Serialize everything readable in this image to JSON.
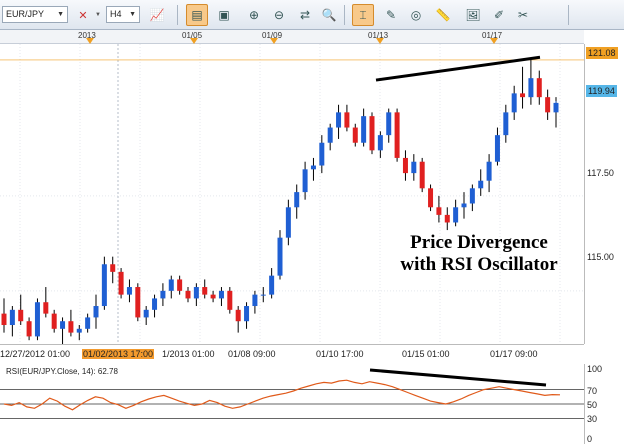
{
  "toolbar": {
    "symbol": "EUR/JPY",
    "timeframe": "H4",
    "buttons": [
      {
        "name": "chart-type-icon",
        "glyph": "📈"
      },
      {
        "name": "bar-chart-icon",
        "glyph": "▤",
        "active": true
      },
      {
        "name": "window-icon",
        "glyph": "▣"
      },
      {
        "name": "zoom-in-icon",
        "glyph": "⊕"
      },
      {
        "name": "zoom-out-icon",
        "glyph": "⊖"
      },
      {
        "name": "scroll-icon",
        "glyph": "⇄"
      },
      {
        "name": "magnifier-icon",
        "glyph": "🔍"
      },
      {
        "name": "cursor-icon",
        "glyph": "⌶",
        "active": true
      },
      {
        "name": "note-icon",
        "glyph": "✎"
      },
      {
        "name": "indicator-icon",
        "glyph": "◎"
      },
      {
        "name": "ruler-icon",
        "glyph": "📏"
      },
      {
        "name": "image-icon",
        "glyph": "🖼"
      },
      {
        "name": "edit-icon",
        "glyph": "✐"
      },
      {
        "name": "settings-icon",
        "glyph": "✂"
      }
    ]
  },
  "timeline": {
    "labels": [
      "2013",
      "01/05",
      "01/09",
      "01/13",
      "01/17"
    ]
  },
  "price_axis": {
    "ticks": [
      "117.50",
      "115.00"
    ],
    "high_badge": "121.08",
    "current_badge": "119.94",
    "high_badge_color": "#f0a023",
    "current_badge_color": "#56b6e8"
  },
  "x_axis": {
    "labels": [
      "12/27/2012 01:00",
      "01/02/2013 17:00",
      "1/2013 01:00",
      "01/08 09:00",
      "01/10 17:00",
      "01/15 01:00",
      "01/17 09:00"
    ],
    "highlight_index": 1
  },
  "rsi": {
    "legend": "RSI(EUR/JPY.Close, 14): 62.78",
    "axis_labels": [
      "100",
      "70",
      "50",
      "30",
      "0"
    ]
  },
  "annotation": {
    "line1": "Price Divergence",
    "line2": "with RSI Oscillator"
  },
  "colors": {
    "bull": "#1f5fd3",
    "bear": "#e02020",
    "rsi_line": "#e05a1a"
  },
  "chart_data": [
    {
      "type": "candlestick",
      "symbol": "EUR/JPY",
      "timeframe": "H4",
      "ylim": [
        113.6,
        121.5
      ],
      "ticks": [
        115.0,
        117.5
      ],
      "candles": [
        [
          114.4,
          114.8,
          113.9,
          114.1
        ],
        [
          114.1,
          114.6,
          113.8,
          114.5
        ],
        [
          114.5,
          114.9,
          114.1,
          114.2
        ],
        [
          114.2,
          114.3,
          113.7,
          113.8
        ],
        [
          113.8,
          114.8,
          113.7,
          114.7
        ],
        [
          114.7,
          115.1,
          114.3,
          114.4
        ],
        [
          114.4,
          114.5,
          113.9,
          114.0
        ],
        [
          114.0,
          114.3,
          113.6,
          114.2
        ],
        [
          114.2,
          114.5,
          113.8,
          113.9
        ],
        [
          113.9,
          114.1,
          113.7,
          114.0
        ],
        [
          114.0,
          114.4,
          113.9,
          114.3
        ],
        [
          114.3,
          114.9,
          114.0,
          114.6
        ],
        [
          114.6,
          115.9,
          114.5,
          115.7
        ],
        [
          115.7,
          115.9,
          115.2,
          115.5
        ],
        [
          115.5,
          115.6,
          114.8,
          114.9
        ],
        [
          114.9,
          115.3,
          114.7,
          115.1
        ],
        [
          115.1,
          115.2,
          114.2,
          114.3
        ],
        [
          114.3,
          114.6,
          114.1,
          114.5
        ],
        [
          114.5,
          114.9,
          114.3,
          114.8
        ],
        [
          114.8,
          115.2,
          114.6,
          115.0
        ],
        [
          115.0,
          115.4,
          114.8,
          115.3
        ],
        [
          115.3,
          115.4,
          114.9,
          115.0
        ],
        [
          115.0,
          115.1,
          114.7,
          114.8
        ],
        [
          114.8,
          115.2,
          114.6,
          115.1
        ],
        [
          115.1,
          115.3,
          114.8,
          114.9
        ],
        [
          114.9,
          115.0,
          114.7,
          114.8
        ],
        [
          114.8,
          115.1,
          114.6,
          115.0
        ],
        [
          115.0,
          115.1,
          114.4,
          114.5
        ],
        [
          114.5,
          114.6,
          113.9,
          114.2
        ],
        [
          114.2,
          114.7,
          114.0,
          114.6
        ],
        [
          114.6,
          115.0,
          114.4,
          114.9
        ],
        [
          114.9,
          115.1,
          114.7,
          114.9
        ],
        [
          114.9,
          115.6,
          114.8,
          115.4
        ],
        [
          115.4,
          116.6,
          115.3,
          116.4
        ],
        [
          116.4,
          117.4,
          116.2,
          117.2
        ],
        [
          117.2,
          117.8,
          116.9,
          117.6
        ],
        [
          117.6,
          118.4,
          117.4,
          118.2
        ],
        [
          118.2,
          118.5,
          117.9,
          118.3
        ],
        [
          118.3,
          119.1,
          118.1,
          118.9
        ],
        [
          118.9,
          119.4,
          118.7,
          119.3
        ],
        [
          119.3,
          119.9,
          119.0,
          119.7
        ],
        [
          119.7,
          119.9,
          119.2,
          119.3
        ],
        [
          119.3,
          119.4,
          118.8,
          118.9
        ],
        [
          118.9,
          119.8,
          118.8,
          119.6
        ],
        [
          119.6,
          119.7,
          118.6,
          118.7
        ],
        [
          118.7,
          119.2,
          118.5,
          119.1
        ],
        [
          119.1,
          119.8,
          118.9,
          119.7
        ],
        [
          119.7,
          119.8,
          118.4,
          118.5
        ],
        [
          118.5,
          118.7,
          117.9,
          118.1
        ],
        [
          118.1,
          118.6,
          117.9,
          118.4
        ],
        [
          118.4,
          118.5,
          117.6,
          117.7
        ],
        [
          117.7,
          117.8,
          117.1,
          117.2
        ],
        [
          117.2,
          117.5,
          116.8,
          117.0
        ],
        [
          117.0,
          117.2,
          116.6,
          116.8
        ],
        [
          116.8,
          117.4,
          116.7,
          117.2
        ],
        [
          117.2,
          117.6,
          116.9,
          117.3
        ],
        [
          117.3,
          117.8,
          117.1,
          117.7
        ],
        [
          117.7,
          118.2,
          117.5,
          117.9
        ],
        [
          117.9,
          118.6,
          117.6,
          118.4
        ],
        [
          118.4,
          119.3,
          118.3,
          119.1
        ],
        [
          119.1,
          119.9,
          118.9,
          119.7
        ],
        [
          119.7,
          120.4,
          119.5,
          120.2
        ],
        [
          120.2,
          120.9,
          119.8,
          120.1
        ],
        [
          120.1,
          121.08,
          119.9,
          120.6
        ],
        [
          120.6,
          120.8,
          119.9,
          120.1
        ],
        [
          120.1,
          120.3,
          119.5,
          119.7
        ],
        [
          119.7,
          120.1,
          119.3,
          119.94
        ]
      ]
    },
    {
      "type": "line",
      "name": "RSI(EUR/JPY.Close, 14)",
      "last_value": 62.78,
      "ylim": [
        0,
        100
      ],
      "levels": [
        70,
        50,
        30
      ],
      "values": [
        50,
        48,
        52,
        46,
        44,
        50,
        58,
        54,
        47,
        42,
        49,
        55,
        60,
        58,
        52,
        49,
        44,
        48,
        53,
        57,
        60,
        62,
        58,
        54,
        51,
        48,
        50,
        55,
        52,
        47,
        44,
        46,
        50,
        54,
        58,
        61,
        63,
        65,
        68,
        72,
        75,
        78,
        80,
        79,
        82,
        83,
        80,
        78,
        81,
        79,
        77,
        74,
        70,
        66,
        62,
        58,
        54,
        52,
        50,
        53,
        57,
        62,
        66,
        70,
        72,
        74,
        72,
        70,
        68,
        66,
        64,
        62,
        63,
        62.78
      ]
    }
  ]
}
